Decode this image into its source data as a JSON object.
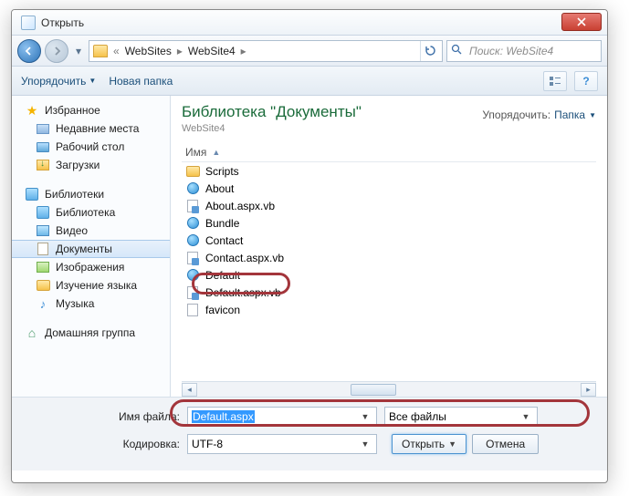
{
  "window": {
    "title": "Открыть"
  },
  "nav": {
    "crumbs": [
      "WebSites",
      "WebSite4"
    ],
    "search_placeholder": "Поиск: WebSite4"
  },
  "toolbar": {
    "organize": "Упорядочить",
    "new_folder": "Новая папка"
  },
  "tree": {
    "favorites": {
      "label": "Избранное",
      "items": [
        "Недавние места",
        "Рабочий стол",
        "Загрузки"
      ]
    },
    "libraries": {
      "label": "Библиотеки",
      "items": [
        "Библиотека",
        "Видео",
        "Документы",
        "Изображения",
        "Изучение языка",
        "Музыка"
      ],
      "selected_index": 2
    },
    "homegroup": {
      "label": "Домашняя группа"
    }
  },
  "content": {
    "lib_title": "Библиотека \"Документы\"",
    "lib_sub": "WebSite4",
    "arrange_label": "Упорядочить:",
    "arrange_value": "Папка",
    "col_name": "Имя",
    "files": [
      {
        "name": "Scripts",
        "type": "folder"
      },
      {
        "name": "About",
        "type": "web"
      },
      {
        "name": "About.aspx.vb",
        "type": "vb"
      },
      {
        "name": "Bundle",
        "type": "web"
      },
      {
        "name": "Contact",
        "type": "web"
      },
      {
        "name": "Contact.aspx.vb",
        "type": "vb"
      },
      {
        "name": "Default",
        "type": "web"
      },
      {
        "name": "Default.aspx.vb",
        "type": "vb"
      },
      {
        "name": "favicon",
        "type": "ico"
      }
    ]
  },
  "footer": {
    "filename_label": "Имя файла:",
    "filename_value": "Default.aspx",
    "filter_value": "Все файлы",
    "encoding_label": "Кодировка:",
    "encoding_value": "UTF-8",
    "open": "Открыть",
    "cancel": "Отмена"
  }
}
